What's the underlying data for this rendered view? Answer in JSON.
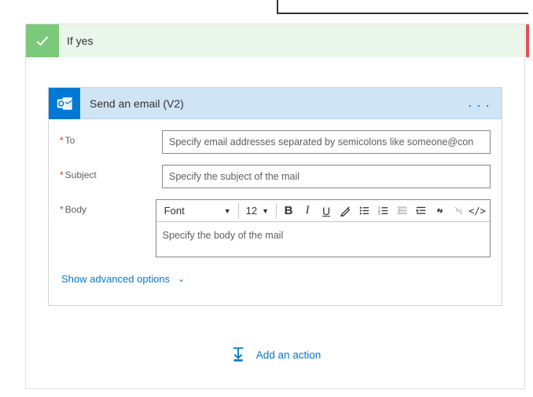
{
  "condition": {
    "title": "If yes"
  },
  "action": {
    "title": "Send an email (V2)",
    "menu_dots": ". . .",
    "fields": {
      "to": {
        "label": "To",
        "placeholder": "Specify email addresses separated by semicolons like someone@con"
      },
      "subject": {
        "label": "Subject",
        "placeholder": "Specify the subject of the mail"
      },
      "body": {
        "label": "Body",
        "placeholder": "Specify the body of the mail"
      }
    },
    "toolbar": {
      "font": "Font",
      "size": "12",
      "bold": "B",
      "italic": "I",
      "underline": "U",
      "code": "</>"
    },
    "advanced_label": "Show advanced options"
  },
  "add_action_label": "Add an action"
}
